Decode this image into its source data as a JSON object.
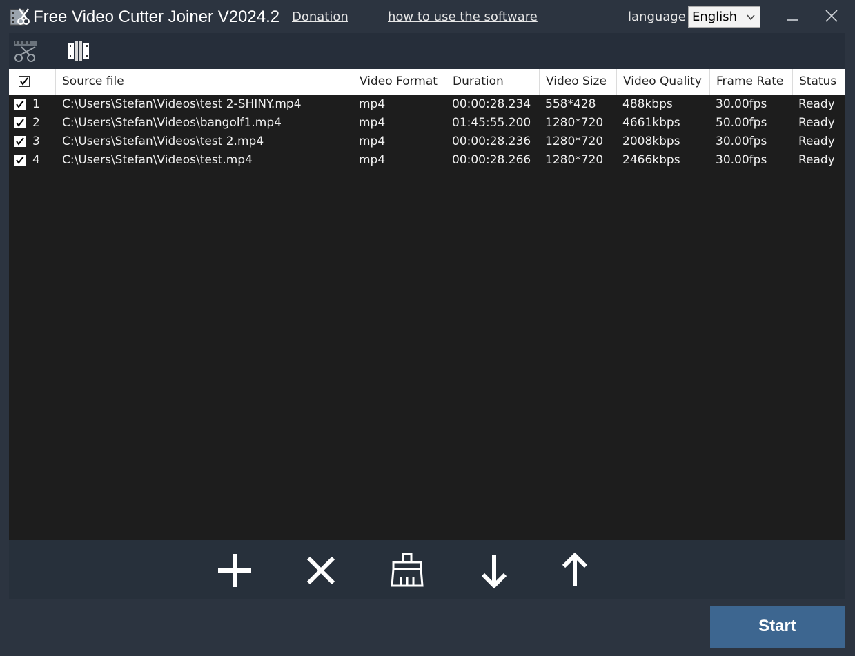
{
  "app": {
    "title": "Free Video Cutter Joiner V2024.2",
    "donation_link": "Donation",
    "howto_link": "how to use the software",
    "language_label": "language",
    "language_value": "English"
  },
  "toolbar": {
    "tools": [
      {
        "icon": "cutter-icon"
      },
      {
        "icon": "joiner-icon"
      }
    ]
  },
  "table": {
    "columns": [
      "Source file",
      "Video Format",
      "Duration",
      "Video Size",
      "Video Quality",
      "Frame Rate",
      "Status"
    ],
    "rows": [
      {
        "num": "1",
        "checked": true,
        "source": "C:\\Users\\Stefan\\Videos\\test 2-SHINY.mp4",
        "format": "mp4",
        "duration": "00:00:28.234",
        "size": "558*428",
        "quality": "488kbps",
        "fps": "30.00fps",
        "status": "Ready"
      },
      {
        "num": "2",
        "checked": true,
        "source": "C:\\Users\\Stefan\\Videos\\bangolf1.mp4",
        "format": "mp4",
        "duration": "01:45:55.200",
        "size": "1280*720",
        "quality": "4661kbps",
        "fps": "50.00fps",
        "status": "Ready"
      },
      {
        "num": "3",
        "checked": true,
        "source": "C:\\Users\\Stefan\\Videos\\test 2.mp4",
        "format": "mp4",
        "duration": "00:00:28.236",
        "size": "1280*720",
        "quality": "2008kbps",
        "fps": "30.00fps",
        "status": "Ready"
      },
      {
        "num": "4",
        "checked": true,
        "source": "C:\\Users\\Stefan\\Videos\\test.mp4",
        "format": "mp4",
        "duration": "00:00:28.266",
        "size": "1280*720",
        "quality": "2466kbps",
        "fps": "30.00fps",
        "status": "Ready"
      }
    ]
  },
  "actions": [
    {
      "icon": "add-icon"
    },
    {
      "icon": "remove-icon"
    },
    {
      "icon": "clear-icon"
    },
    {
      "icon": "move-down-icon"
    },
    {
      "icon": "move-up-icon"
    }
  ],
  "start_label": "Start",
  "colors": {
    "background": "#2c3440",
    "list_background": "#1d1d1d",
    "start_button": "#3d6690"
  }
}
